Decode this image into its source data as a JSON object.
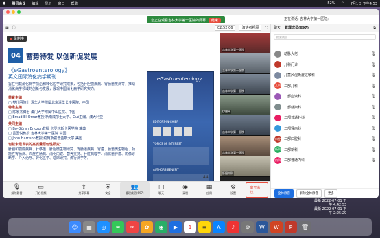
{
  "menubar": {
    "app": "腾讯会议",
    "items": [
      "编辑",
      "显示",
      "窗口",
      "帮助"
    ],
    "status_time": "7月1日 下午4:53",
    "battery": "52%"
  },
  "share_bar": {
    "text": "您正在观看吉林大学第一医院的屏幕",
    "notice": "正在讲话: 吉林大学第一医院;",
    "stop_label": "结束"
  },
  "toolbar": {
    "timer": "02:52:06",
    "speaker_view": "演讲者视图",
    "other": "正在讲话: 吉林大学第一医院;"
  },
  "slide": {
    "recording": "录制中",
    "number": "04",
    "title": "蓄势待发 以创新促发展",
    "journal_name": "《eGastroenterology》",
    "journal_sub": "英文国际消化病学期刊",
    "lines": [
      "旨在刊载消化病学前沿和转化医学研究成果，包括肝胆胰疾病、胃肠道疾病等，推动消化病学领域的创新与发展，展现中国消化病学研究实力。",
      "荣誉主编",
      "□ 樊代明院士 清华大学附属北京清华长庚医院、中国",
      "特邀主编",
      "□ 陈家杰博士 澳门大学附属中山医院、中国",
      "□ Emad El-Omar教授 新南威尔士大学、Gut主编、澳大利亚",
      "共同主编",
      "□ Bo-Göran Ericzon教授 卡罗林斯卡医学院 瑞典",
      "□ 吕国悦教授 吉林大学第一医院 中国",
      "□ John Harrison教授 约翰斯霍普金斯大学 美国",
      "刊载未经发表的高质量原创性研究：",
      "肝胆和胰腺疾病、肝移植、肝胆微生物研究、胃肠道疾病、胃癌、肠道微生物组、功能性胃肠病、炎症性肠病、消化内镜、营养支持、肝脏病理学、消化道肿瘤、影像诊断学、介入治疗、转化医学、临床研究、流行病学等。"
    ],
    "cover_title": "eGastroenterology",
    "cover_labels": [
      "EDITORS-IN-CHIEF",
      "TOPICS OF INTEREST",
      "AUTHORS BENEFIT"
    ],
    "page_no": "44"
  },
  "videos": [
    {
      "label": "吉林大学第一医院"
    },
    {
      "label": "吉林大学第一医院"
    },
    {
      "label": "吉林大学第一医院"
    },
    {
      "label": "伊腊州"
    },
    {
      "label": "吉林大学第一医院"
    },
    {
      "label": "吉林大学第一医院"
    },
    {
      "label": "肝胆内科"
    }
  ],
  "controls": [
    {
      "label": "解除静音",
      "icon": "mic"
    },
    {
      "label": "开启视频",
      "icon": "camera"
    },
    {
      "label": "共享屏幕",
      "icon": "share"
    },
    {
      "label": "安全",
      "icon": "shield"
    },
    {
      "label": "管理成员(697)",
      "icon": "people"
    },
    {
      "label": "聊天",
      "icon": "chat"
    },
    {
      "label": "录制",
      "icon": "record"
    },
    {
      "label": "应用",
      "icon": "apps"
    },
    {
      "label": "设置",
      "icon": "gear"
    }
  ],
  "leave_label": "离开会议",
  "panel": {
    "tab1": "聊天",
    "tab2": "管理成员(697)",
    "search_placeholder": "搜索成员",
    "members": [
      {
        "name": "动脉大佬",
        "color": "#888"
      },
      {
        "name": "儿科门诊",
        "color": "#c0392b"
      },
      {
        "name": "儿童风湿免疫过敏科",
        "color": "#7d8aa0"
      },
      {
        "name": "二部儿科",
        "color": "#e74c3c"
      },
      {
        "name": "二部血液科",
        "color": "#9b59b6"
      },
      {
        "name": "二部感染科",
        "color": "#7f8c8d"
      },
      {
        "name": "二部普通外科",
        "color": "#e91e63"
      },
      {
        "name": "二部肾内科",
        "color": "#3498db"
      },
      {
        "name": "二部口腔科",
        "color": "#c0392b"
      },
      {
        "name": "二部新科",
        "color": "#27ae60"
      },
      {
        "name": "二部普通内科",
        "color": "#e91e63"
      }
    ],
    "btn_mute_all": "全体静音",
    "btn_unmute_all": "解除全体静音",
    "btn_more": "更多"
  },
  "timestamp": {
    "line1": "最新 2022-07-01 下",
    "line2": "午 4:42:53",
    "line3": "最新 2022-07-01 下",
    "line4": "午 2:25:29"
  }
}
